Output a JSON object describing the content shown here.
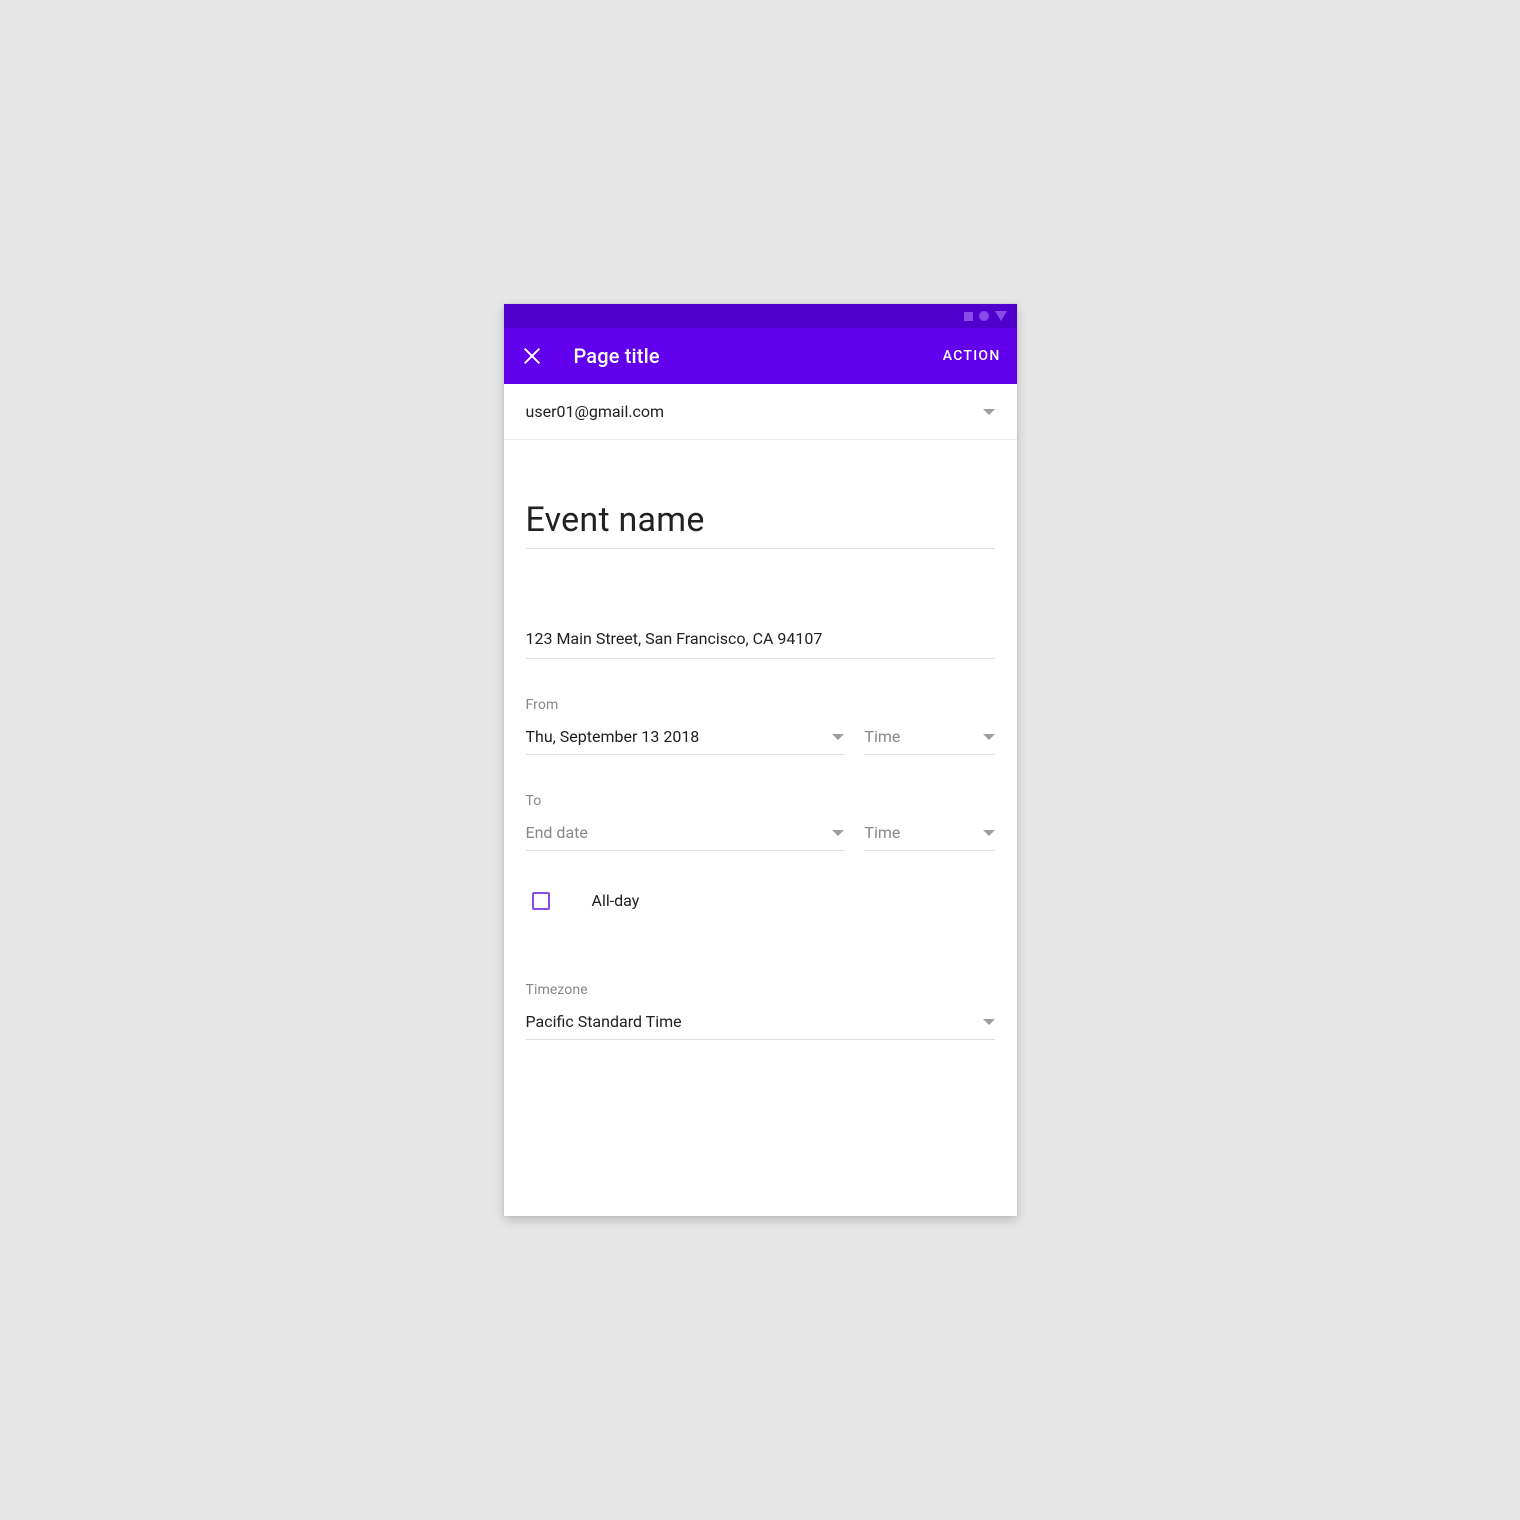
{
  "appbar": {
    "title": "Page title",
    "action": "ACTION"
  },
  "account": {
    "email": "user01@gmail.com"
  },
  "event": {
    "name": "Event name",
    "address": "123 Main Street, San Francisco, CA 94107"
  },
  "from": {
    "label": "From",
    "date": "Thu, September 13 2018",
    "time_placeholder": "Time"
  },
  "to": {
    "label": "To",
    "date_placeholder": "End date",
    "time_placeholder": "Time"
  },
  "allday": {
    "label": "All-day"
  },
  "timezone": {
    "label": "Timezone",
    "value": "Pacific Standard Time"
  }
}
